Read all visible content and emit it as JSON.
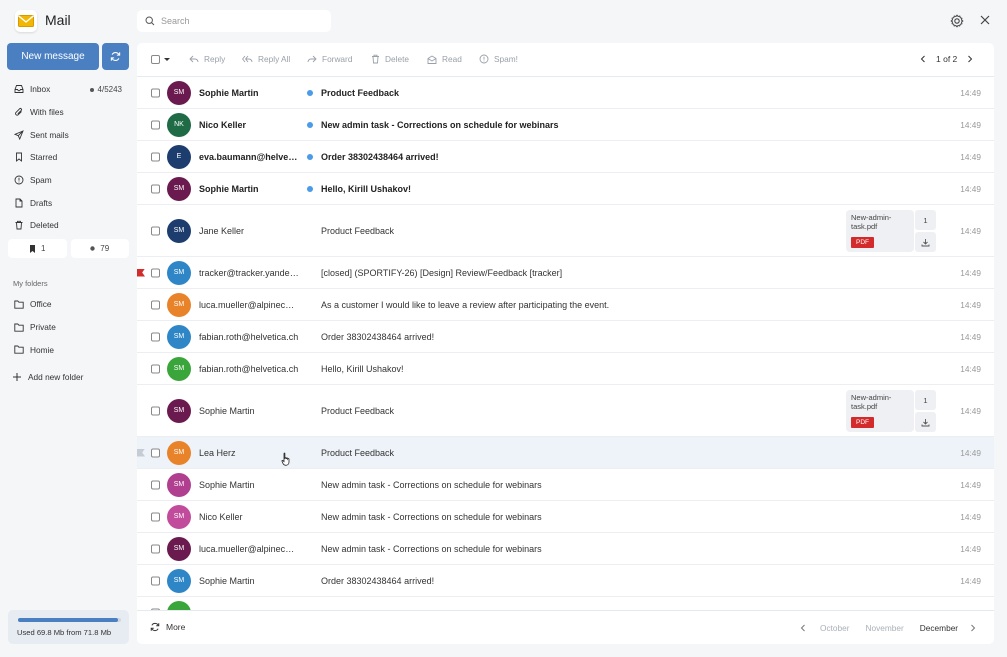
{
  "app": {
    "title": "Mail"
  },
  "sidebar": {
    "new_message_label": "New message",
    "nav": [
      {
        "label": "Inbox",
        "icon": "inbox-icon",
        "count": "4/5243"
      },
      {
        "label": "With files",
        "icon": "paperclip-icon"
      },
      {
        "label": "Sent mails",
        "icon": "send-icon"
      },
      {
        "label": "Starred",
        "icon": "bookmark-icon"
      },
      {
        "label": "Spam",
        "icon": "spam-icon"
      },
      {
        "label": "Drafts",
        "icon": "drafts-icon"
      },
      {
        "label": "Deleted",
        "icon": "trash-icon"
      }
    ],
    "chips": [
      {
        "icon": "bookmark-icon",
        "value": "1"
      },
      {
        "icon": "dot-icon",
        "value": "79"
      }
    ],
    "folders_heading": "My folders",
    "folders": [
      {
        "label": "Office"
      },
      {
        "label": "Private"
      },
      {
        "label": "Homie"
      }
    ],
    "add_folder_label": "Add new folder",
    "storage": {
      "text": "Used 69.8 Mb from 71.8 Mb",
      "used_fraction": 0.972
    }
  },
  "search": {
    "placeholder": "Search",
    "value": ""
  },
  "toolbar": {
    "reply": "Reply",
    "reply_all": "Reply All",
    "forward": "Forward",
    "delete": "Delete",
    "read": "Read",
    "spam": "Spam!",
    "page_info": "1 of 2"
  },
  "emails": [
    {
      "initials": "SM",
      "avatar_color": "#6b1a4f",
      "from": "Sophie Martin",
      "subject": "Product Feedback",
      "time": "14:49",
      "unread": true
    },
    {
      "initials": "NK",
      "avatar_color": "#1e6b45",
      "from": "Nico Keller",
      "subject": "New admin task -  Corrections on schedule for webinars",
      "time": "14:49",
      "unread": true
    },
    {
      "initials": "E",
      "avatar_color": "#1c3d6e",
      "from": "eva.baumann@helvetic...",
      "subject": "Order 38302438464 arrived!",
      "time": "14:49",
      "unread": true
    },
    {
      "initials": "SM",
      "avatar_color": "#6b1a4f",
      "from": "Sophie Martin",
      "subject": "Hello, Kirill Ushakov!",
      "time": "14:49",
      "unread": true
    },
    {
      "initials": "SM",
      "avatar_color": "#1c3d6e",
      "from": "Jane Keller",
      "subject": "Product Feedback",
      "time": "14:49",
      "attachment": {
        "name": "New-admin-task.pdf",
        "type": "PDF",
        "count": "1"
      }
    },
    {
      "initials": "SM",
      "avatar_color": "#2f86c6",
      "from": "tracker@tracker.yandex.ru",
      "subject": "[closed] (SPORTIFY-26) [Design] Review/Feedback [tracker]",
      "time": "14:49",
      "flag": "red"
    },
    {
      "initials": "SM",
      "avatar_color": "#e8832a",
      "from": "luca.mueller@alpinecorp.ch",
      "subject": "As a customer I would like to leave a review after participating the event.",
      "time": "14:49"
    },
    {
      "initials": "SM",
      "avatar_color": "#2f86c6",
      "from": "fabian.roth@helvetica.ch",
      "subject": "Order 38302438464 arrived!",
      "time": "14:49"
    },
    {
      "initials": "SM",
      "avatar_color": "#3aa53a",
      "from": "fabian.roth@helvetica.ch",
      "subject": "Hello, Kirill Ushakov!",
      "time": "14:49"
    },
    {
      "initials": "SM",
      "avatar_color": "#6b1a4f",
      "from": "Sophie Martin",
      "subject": "Product Feedback",
      "time": "14:49",
      "attachment": {
        "name": "New-admin-task.pdf",
        "type": "PDF",
        "count": "1"
      }
    },
    {
      "initials": "SM",
      "avatar_color": "#e8832a",
      "from": "Lea Herz",
      "subject": "Product Feedback",
      "time": "14:49",
      "flag": "grey",
      "highlighted": true
    },
    {
      "initials": "SM",
      "avatar_color": "#b03f8f",
      "from": "Sophie Martin",
      "subject": "New admin task -  Corrections on schedule for webinars",
      "time": "14:49"
    },
    {
      "initials": "SM",
      "avatar_color": "#c24c9c",
      "from": "Nico Keller",
      "subject": "New admin task -  Corrections on schedule for webinars",
      "time": "14:49"
    },
    {
      "initials": "SM",
      "avatar_color": "#6b1a4f",
      "from": "luca.mueller@alpinecorp.ch",
      "subject": "New admin task -  Corrections on schedule for webinars",
      "time": "14:49"
    },
    {
      "initials": "SM",
      "avatar_color": "#2f86c6",
      "from": "Sophie Martin",
      "subject": "Order 38302438464 arrived!",
      "time": "14:49"
    },
    {
      "initials": "",
      "avatar_color": "#3aa53a",
      "from": "",
      "subject": "",
      "time": ""
    }
  ],
  "footer": {
    "more_label": "More",
    "months": [
      "October",
      "November",
      "December"
    ],
    "active_month": "December"
  },
  "colors": {
    "accent": "#4a7fc1",
    "unread_dot": "#4a9be8",
    "pdf": "#d32b2b",
    "flag": "#d22c2c"
  }
}
